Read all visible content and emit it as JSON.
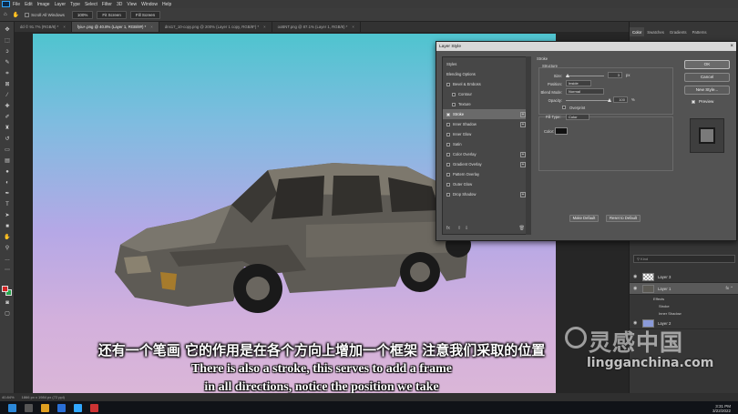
{
  "menubar": {
    "items": [
      "File",
      "Edit",
      "Image",
      "Layer",
      "Type",
      "Select",
      "Filter",
      "3D",
      "View",
      "Window",
      "Help"
    ]
  },
  "options": {
    "scroll_all": "Scroll All Windows",
    "zoom": "100%",
    "fit_screen": "Fit Screen",
    "fill_screen": "Fill Screen"
  },
  "doc_tabs": [
    {
      "label": "dd © 91.7% (RGB/8) *",
      "active": false
    },
    {
      "label": "fyiu+.png @ 40.8% (Layer 1, RGB/8#) *",
      "active": true
    },
    {
      "label": "dns17_10-copy.png @ 200% (Layer 1 copy, RGB/8*) *",
      "active": false
    },
    {
      "label": "ooBNT.png @ 87.1% (Layer 1, RGB/8) *",
      "active": false
    }
  ],
  "subtitles": {
    "zh": "还有一个笔画 它的作用是在各个方向上增加一个框架 注意我们采取的位置",
    "en_line1": "There is also a stroke, this serves to add a frame",
    "en_line2": "in all directions, notice the position we take"
  },
  "watermark": {
    "title": "灵感中国",
    "url": "lingganchina.com"
  },
  "status": {
    "zoom": "40.84%",
    "doc": "1866 px x 1984 px (72 ppi)"
  },
  "dialog": {
    "title": "Layer Style",
    "styles_header": "Styles",
    "style_items": [
      {
        "label": "Blending Options",
        "checkbox": false,
        "checked": false,
        "plus": false,
        "selected": false,
        "indent": false
      },
      {
        "label": "Bevel & Emboss",
        "checkbox": true,
        "checked": false,
        "plus": false,
        "selected": false,
        "indent": false
      },
      {
        "label": "Contour",
        "checkbox": true,
        "checked": false,
        "plus": false,
        "selected": false,
        "indent": true
      },
      {
        "label": "Texture",
        "checkbox": true,
        "checked": false,
        "plus": false,
        "selected": false,
        "indent": true
      },
      {
        "label": "Stroke",
        "checkbox": true,
        "checked": true,
        "plus": true,
        "selected": true,
        "indent": false
      },
      {
        "label": "Inner Shadow",
        "checkbox": true,
        "checked": false,
        "plus": true,
        "selected": false,
        "indent": false
      },
      {
        "label": "Inner Glow",
        "checkbox": true,
        "checked": false,
        "plus": false,
        "selected": false,
        "indent": false
      },
      {
        "label": "Satin",
        "checkbox": true,
        "checked": false,
        "plus": false,
        "selected": false,
        "indent": false
      },
      {
        "label": "Color Overlay",
        "checkbox": true,
        "checked": false,
        "plus": true,
        "selected": false,
        "indent": false
      },
      {
        "label": "Gradient Overlay",
        "checkbox": true,
        "checked": false,
        "plus": true,
        "selected": false,
        "indent": false
      },
      {
        "label": "Pattern Overlay",
        "checkbox": true,
        "checked": false,
        "plus": false,
        "selected": false,
        "indent": false
      },
      {
        "label": "Outer Glow",
        "checkbox": true,
        "checked": false,
        "plus": false,
        "selected": false,
        "indent": false
      },
      {
        "label": "Drop Shadow",
        "checkbox": true,
        "checked": false,
        "plus": true,
        "selected": false,
        "indent": false
      }
    ],
    "stroke": {
      "section": "Stroke",
      "structure": "Structure",
      "size_label": "Size:",
      "size_value": "3",
      "size_unit": "px",
      "position_label": "Position:",
      "position_value": "Inside",
      "blend_label": "Blend Mode:",
      "blend_value": "Normal",
      "opacity_label": "Opacity:",
      "opacity_value": "100",
      "opacity_unit": "%",
      "overprint": "Overprint",
      "fill_type_label": "Fill Type:",
      "fill_type_value": "Color",
      "color_label": "Color:",
      "stroke_color": "#111111",
      "make_default": "Make Default",
      "reset_default": "Reset to Default"
    },
    "buttons": {
      "ok": "OK",
      "cancel": "Cancel",
      "new_style": "New Style...",
      "preview": "Preview"
    }
  },
  "right_panel": {
    "tabs": [
      "Color",
      "Swatches",
      "Gradients",
      "Patterns"
    ],
    "layers": [
      {
        "name": "Layer 3",
        "selected": false,
        "thumb": "checker"
      },
      {
        "name": "Layer 1",
        "selected": true,
        "thumb": "car"
      },
      {
        "name": "Layer 2",
        "selected": false,
        "thumb": "checker"
      }
    ],
    "effects_label": "Effects",
    "effects": [
      "Stroke",
      "Inner Shadow"
    ]
  },
  "taskbar": {
    "time": "3:31 PM",
    "date": "3/22/2022"
  }
}
